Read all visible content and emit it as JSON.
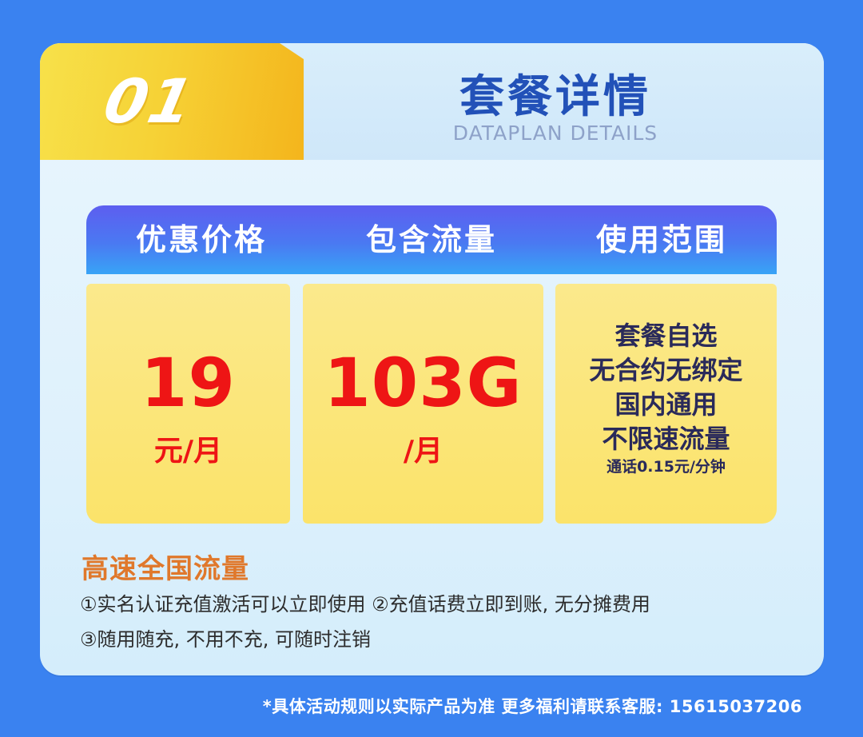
{
  "badge": {
    "number": "01"
  },
  "header": {
    "title": "套餐详情",
    "subtitle": "DATAPLAN DETAILS"
  },
  "table": {
    "headers": [
      "优惠价格",
      "包含流量",
      "使用范围"
    ],
    "price": {
      "value": "19",
      "unit": "元/月"
    },
    "data": {
      "value": "103G",
      "unit": "/月"
    },
    "scope": {
      "features": [
        "套餐自选",
        "无合约无绑定",
        "国内通用",
        "不限速流量"
      ],
      "call_rate": "通话0.15元/分钟"
    }
  },
  "section": {
    "title": "高速全国流量",
    "notes": [
      "①实名认证充值激活可以立即使用 ②充值话费立即到账, 无分摊费用",
      "③随用随充, 不用不充, 可随时注销"
    ]
  },
  "footer": {
    "text": "*具体活动规则以实际产品为准 更多福利请联系客服: 15615037206"
  },
  "colors": {
    "background": "#3a82f0",
    "title": "#2251b8",
    "price_red": "#ee1515",
    "section_orange": "#e0782b",
    "badge_yellow": "#f6d236"
  }
}
